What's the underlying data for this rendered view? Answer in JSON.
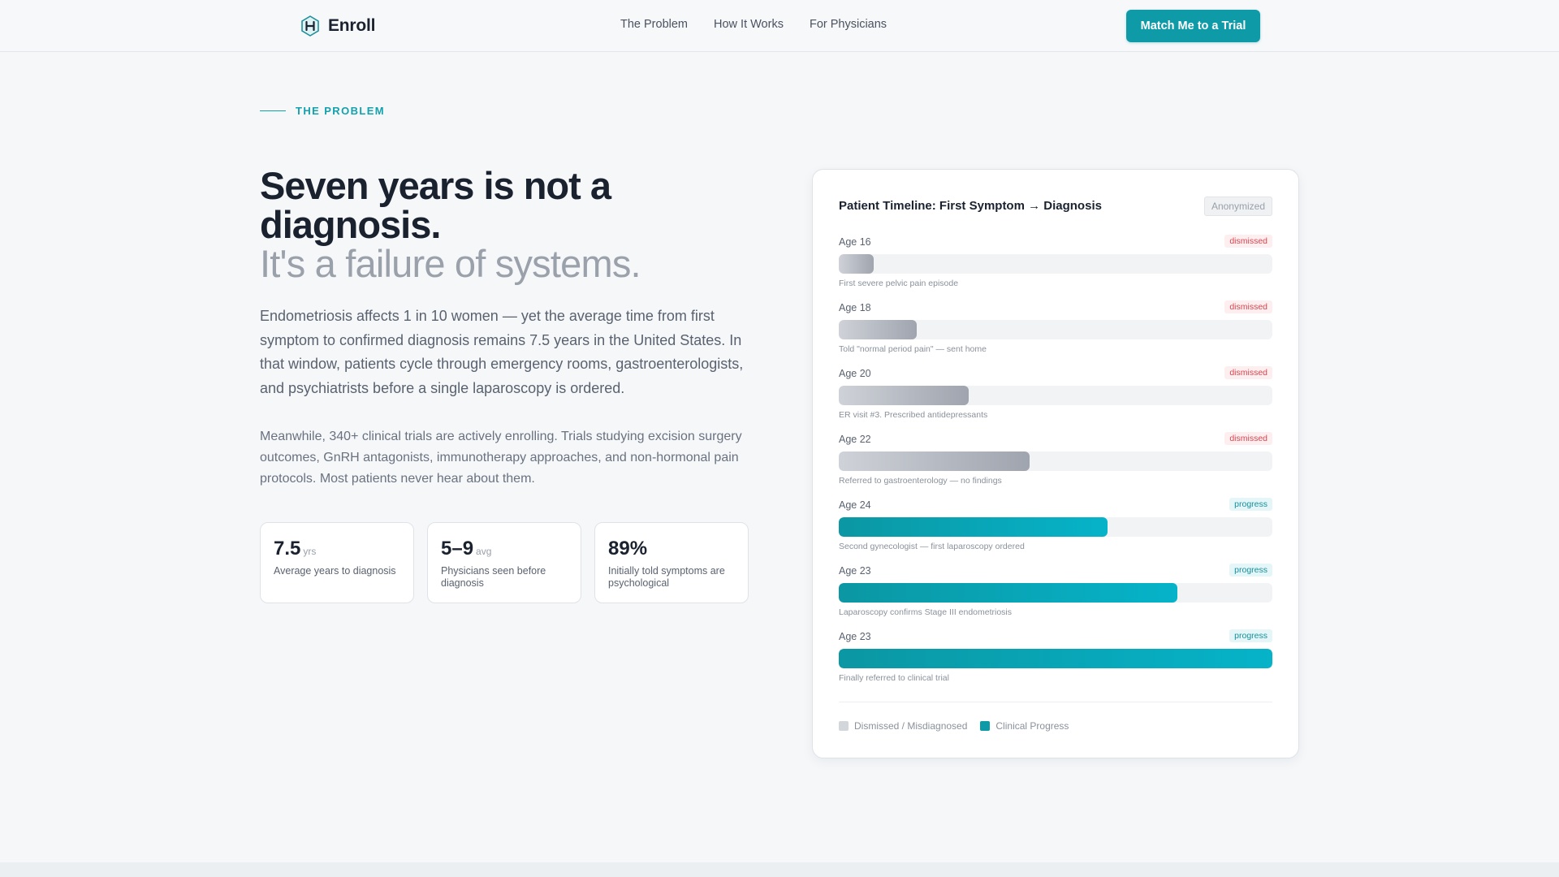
{
  "nav": {
    "brand": "Enroll",
    "links": [
      "The Problem",
      "How It Works",
      "For Physicians"
    ],
    "cta": "Match Me to a Trial"
  },
  "hero": {
    "eyebrow": "THE PROBLEM",
    "headline": "Seven years is not a diagnosis.",
    "subheadline": "It's a failure of systems.",
    "lead": "Endometriosis affects 1 in 10 women — yet the average time from first symptom to confirmed diagnosis remains 7.5 years in the United States. In that window, patients cycle through emergency rooms, gastroenterologists, and psychiatrists before a single laparoscopy is ordered.",
    "body": "Meanwhile, 340+ clinical trials are actively enrolling. Trials studying excision surgery outcomes, GnRH antagonists, immunotherapy approaches, and non-hormonal pain protocols. Most patients never hear about them."
  },
  "stats": [
    {
      "value": "7.5",
      "unit": "yrs",
      "label": "Average years to diagnosis"
    },
    {
      "value": "5–9",
      "unit": "avg",
      "label": "Physicians seen before diagnosis"
    },
    {
      "value": "89%",
      "unit": "",
      "label": "Initially told symptoms are psychological"
    }
  ],
  "timeline": {
    "title": "Patient Timeline: First Symptom → Diagnosis",
    "badge": "Anonymized",
    "rows": [
      {
        "age": "Age 16",
        "status": "dismissed",
        "progress": 0.08,
        "note": "First severe pelvic pain episode"
      },
      {
        "age": "Age 18",
        "status": "dismissed",
        "progress": 0.18,
        "note": "Told \"normal period pain\" — sent home"
      },
      {
        "age": "Age 20",
        "status": "dismissed",
        "progress": 0.3,
        "note": "ER visit #3. Prescribed antidepressants"
      },
      {
        "age": "Age 22",
        "status": "dismissed",
        "progress": 0.44,
        "note": "Referred to gastroenterology — no findings"
      },
      {
        "age": "Age 24",
        "status": "progress",
        "progress": 0.62,
        "note": "Second gynecologist — first laparoscopy ordered"
      },
      {
        "age": "Age 23",
        "status": "progress",
        "progress": 0.78,
        "note": "Laparoscopy confirms Stage III endometriosis"
      },
      {
        "age": "Age 23",
        "status": "progress",
        "progress": 1.0,
        "note": "Finally referred to clinical trial"
      }
    ],
    "legend": [
      {
        "label": "Dismissed / Misdiagnosed",
        "color": "#d3d6db"
      },
      {
        "label": "Clinical Progress",
        "color": "#0f9aa7"
      }
    ]
  },
  "colors": {
    "accent": "#0f9aa7",
    "dismissed": "#d6454f"
  }
}
